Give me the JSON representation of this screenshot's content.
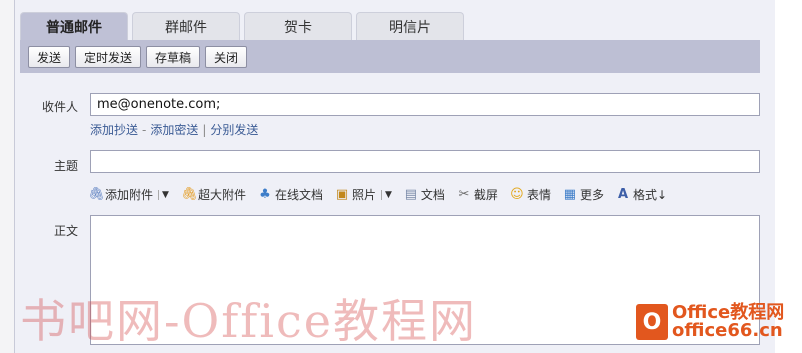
{
  "tabs": [
    {
      "label": "普通邮件",
      "active": true
    },
    {
      "label": "群邮件"
    },
    {
      "label": "贺卡"
    },
    {
      "label": "明信片"
    }
  ],
  "toolbar": {
    "send": "发送",
    "scheduled_send": "定时发送",
    "save_draft": "存草稿",
    "close": "关闭"
  },
  "form": {
    "recipient_label": "收件人",
    "recipient_value": "me@onenote.com;",
    "links": {
      "add_cc": "添加抄送",
      "dash": "-",
      "add_bcc": "添加密送",
      "bar": "|",
      "separate_send": "分别发送"
    },
    "subject_label": "主题",
    "subject_value": "",
    "body_label": "正文"
  },
  "attach_bar": {
    "items": [
      {
        "label": "添加附件",
        "icon": "paperclip-icon",
        "has_menu": true
      },
      {
        "label": "超大附件",
        "icon": "large-paperclip-icon"
      },
      {
        "label": "在线文档",
        "icon": "cloud-doc-icon"
      },
      {
        "label": "照片",
        "icon": "photo-icon",
        "has_menu": true
      },
      {
        "label": "文档",
        "icon": "document-icon"
      },
      {
        "label": "截屏",
        "icon": "screenshot-icon"
      },
      {
        "label": "表情",
        "icon": "emoji-icon"
      },
      {
        "label": "更多",
        "icon": "more-icon"
      },
      {
        "label": "格式↓",
        "icon": "format-icon"
      }
    ]
  },
  "watermark": {
    "text": "书吧网-Office教程网"
  },
  "logo": {
    "glyph": "O",
    "line1": "Office教程网",
    "line2": "office66.cn"
  }
}
